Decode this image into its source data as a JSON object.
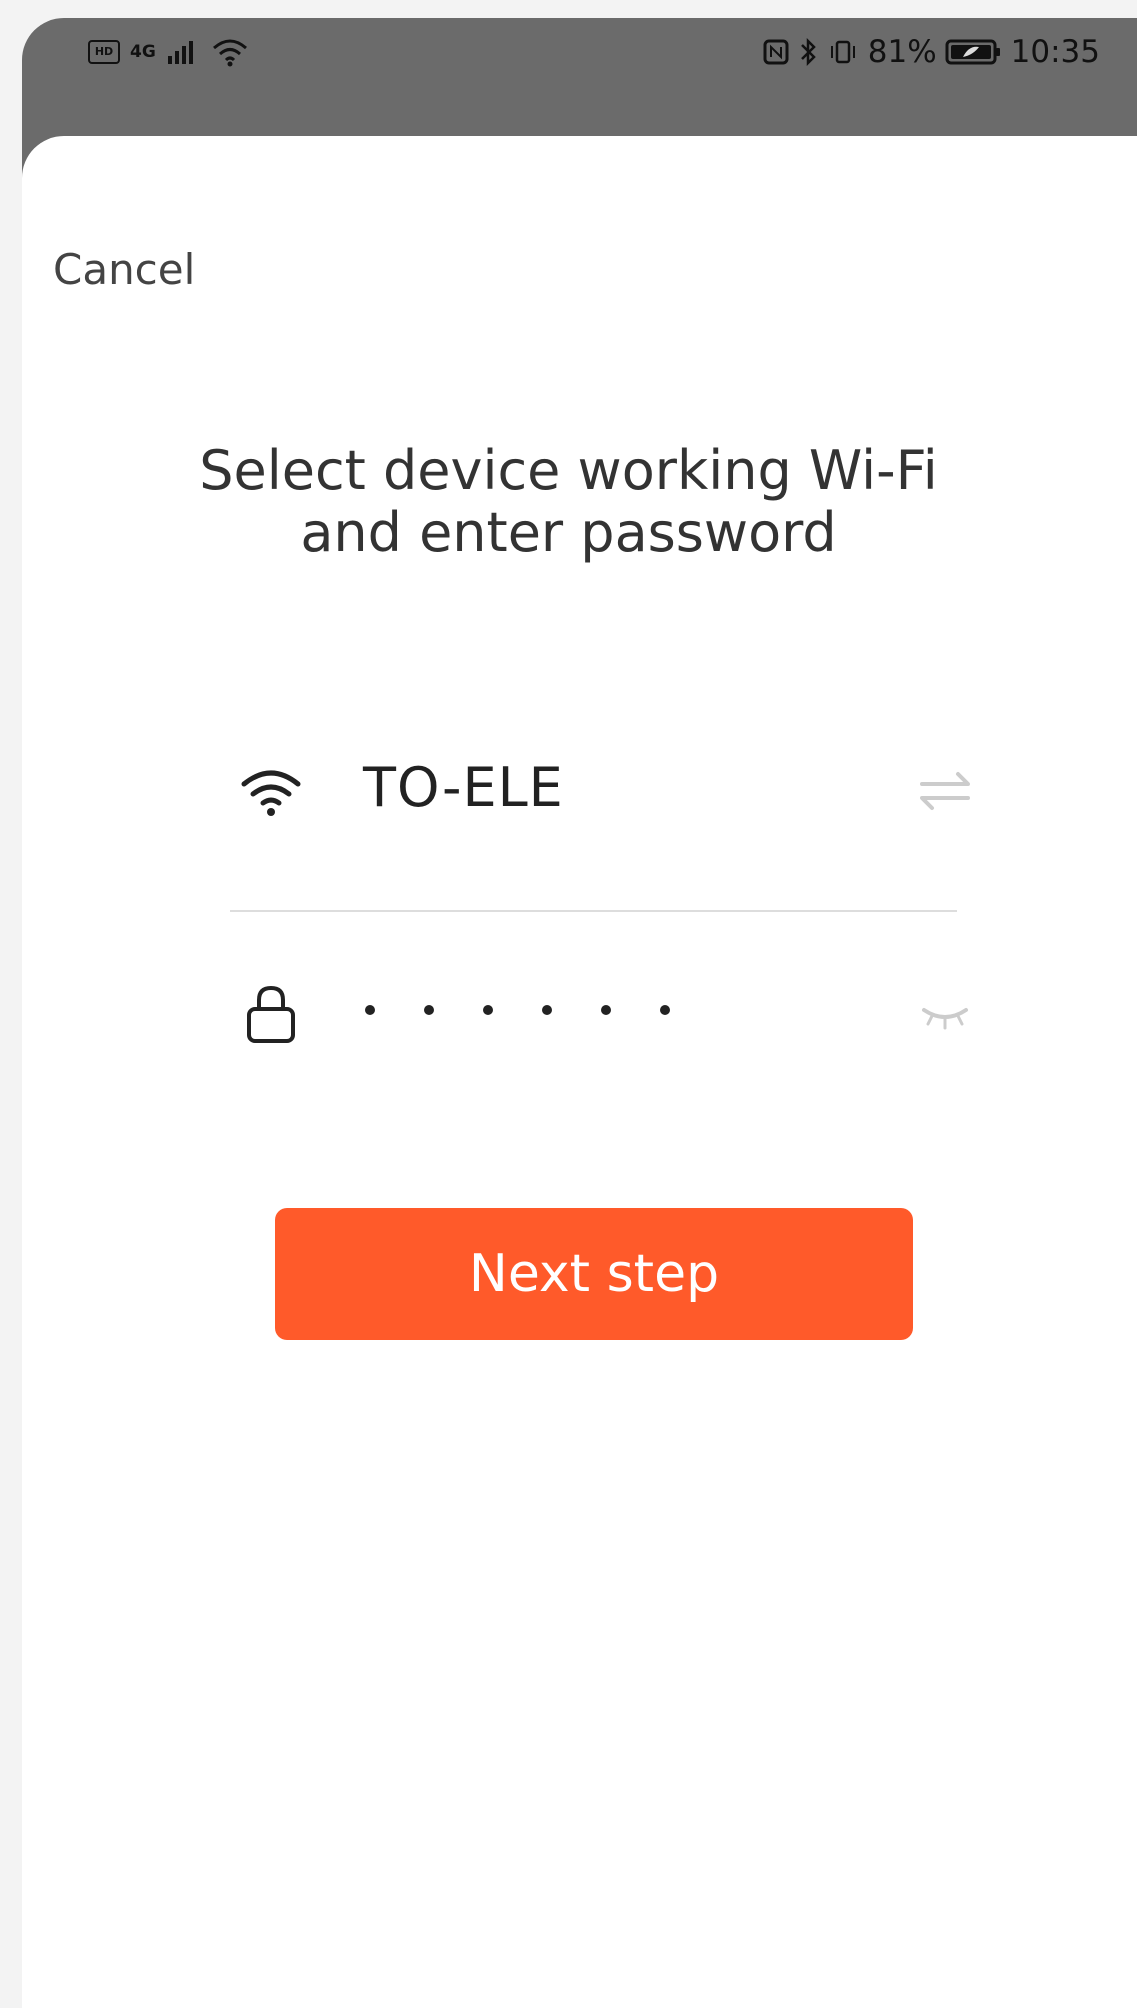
{
  "status_bar": {
    "time": "10:35",
    "battery_percent": "81%",
    "network_label": "4G",
    "left_icons": [
      "hd-icon",
      "signal-icon",
      "wifi-icon"
    ],
    "right_icons": [
      "nfc-icon",
      "bluetooth-icon",
      "vibrate-icon",
      "battery-icon"
    ]
  },
  "header": {
    "cancel_label": "Cancel"
  },
  "main": {
    "title_line1": "Select device working Wi-Fi",
    "title_line2": "and enter password",
    "wifi_ssid": "TO-ELE",
    "password_mask": "••••••",
    "next_button_label": "Next step"
  },
  "colors": {
    "accent": "#ff5a2a",
    "status_bar_bg": "#6b6b6b",
    "sheet_bg": "#ffffff",
    "text_primary": "#222222"
  }
}
